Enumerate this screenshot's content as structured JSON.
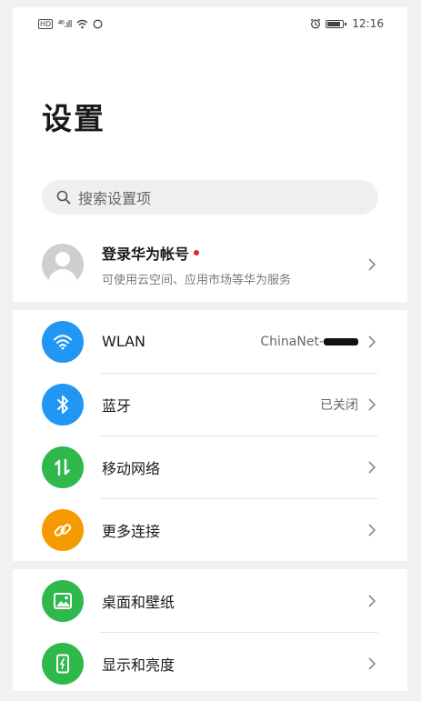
{
  "status_bar": {
    "hd_label": "HD",
    "signal": "⁴⁶.ıll",
    "time": "12:16"
  },
  "page": {
    "title": "设置"
  },
  "search": {
    "placeholder": "搜索设置项"
  },
  "account": {
    "title": "登录华为帐号",
    "subtitle": "可使用云空间、应用市场等华为服务"
  },
  "groups": [
    {
      "items": [
        {
          "label": "WLAN",
          "value": "ChinaNet-",
          "icon": "wifi-icon",
          "color": "#2196f3"
        },
        {
          "label": "蓝牙",
          "value": "已关闭",
          "icon": "bluetooth-icon",
          "color": "#2196f3"
        },
        {
          "label": "移动网络",
          "value": "",
          "icon": "mobile-network-icon",
          "color": "#2fb94a"
        },
        {
          "label": "更多连接",
          "value": "",
          "icon": "link-icon",
          "color": "#f59a00"
        }
      ]
    },
    {
      "items": [
        {
          "label": "桌面和壁纸",
          "value": "",
          "icon": "wallpaper-icon",
          "color": "#2fb94a"
        },
        {
          "label": "显示和亮度",
          "value": "",
          "icon": "display-icon",
          "color": "#2fb94a"
        }
      ]
    }
  ]
}
